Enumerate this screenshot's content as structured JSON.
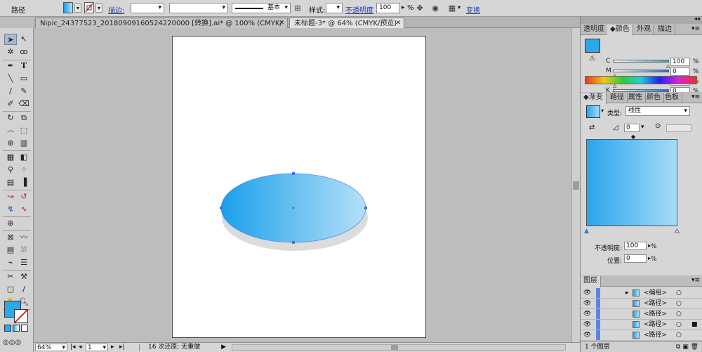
{
  "control_bar": {
    "object_type": "路径",
    "stroke_label": "描边:",
    "stroke_weight": "",
    "variable_width": "",
    "brush_profile": "基本",
    "style_label": "样式:",
    "opacity_label": "不透明度",
    "opacity_value": "100",
    "opacity_unit": "%",
    "transform_link": "变换",
    "fill_color": "#29a8ec"
  },
  "tabs": [
    {
      "label": "Nipic_24377523_20180909160524220000  [转换].ai* @ 100% (CMYK/预览)",
      "close": "✕"
    },
    {
      "label": "未标题-3* @ 64% (CMYK/预览)",
      "close": "✕"
    }
  ],
  "tools": {
    "fill_color": "#29a8ec",
    "stroke_indicator": "none"
  },
  "artwork": {
    "ellipse_gradient_start": "#1aa0ea",
    "ellipse_gradient_end": "#b5e0f8",
    "shadow_color": "#dcdcdc"
  },
  "status_bar": {
    "zoom": "64%",
    "page": "1",
    "undo_info": "16 次还原; 无重做"
  },
  "color_panel": {
    "tabs": [
      "透明度",
      "颜色",
      "外观",
      "描边"
    ],
    "channels": [
      {
        "label": "C",
        "value": "100",
        "color": "#29a8ec"
      },
      {
        "label": "M",
        "value": "0",
        "color": "#2a6cc0"
      },
      {
        "label": "Y",
        "value": "0",
        "color": "#2aa06a"
      },
      {
        "label": "K",
        "value": "0",
        "color": "#2a6cc0"
      }
    ],
    "swatch": "#29a8ec"
  },
  "gradient_panel": {
    "tabs": [
      "渐变",
      "路径",
      "属性",
      "颜色",
      "色板"
    ],
    "type_label": "类型:",
    "type_value": "线性",
    "angle_value": "0",
    "opacity_label": "不透明度:",
    "opacity_value": "100",
    "opacity_unit": "%",
    "location_label": "位置:",
    "location_value": "0",
    "location_unit": "%",
    "preview_start": "#2ba4ec",
    "preview_end": "#a5dcf7"
  },
  "layers_panel": {
    "tab": "图层",
    "rows": [
      {
        "label": "<编组>"
      },
      {
        "label": "<路径>"
      },
      {
        "label": "<路径>"
      },
      {
        "label": "<路径>"
      },
      {
        "label": "<路径>"
      }
    ],
    "footer": "1 个图层"
  }
}
